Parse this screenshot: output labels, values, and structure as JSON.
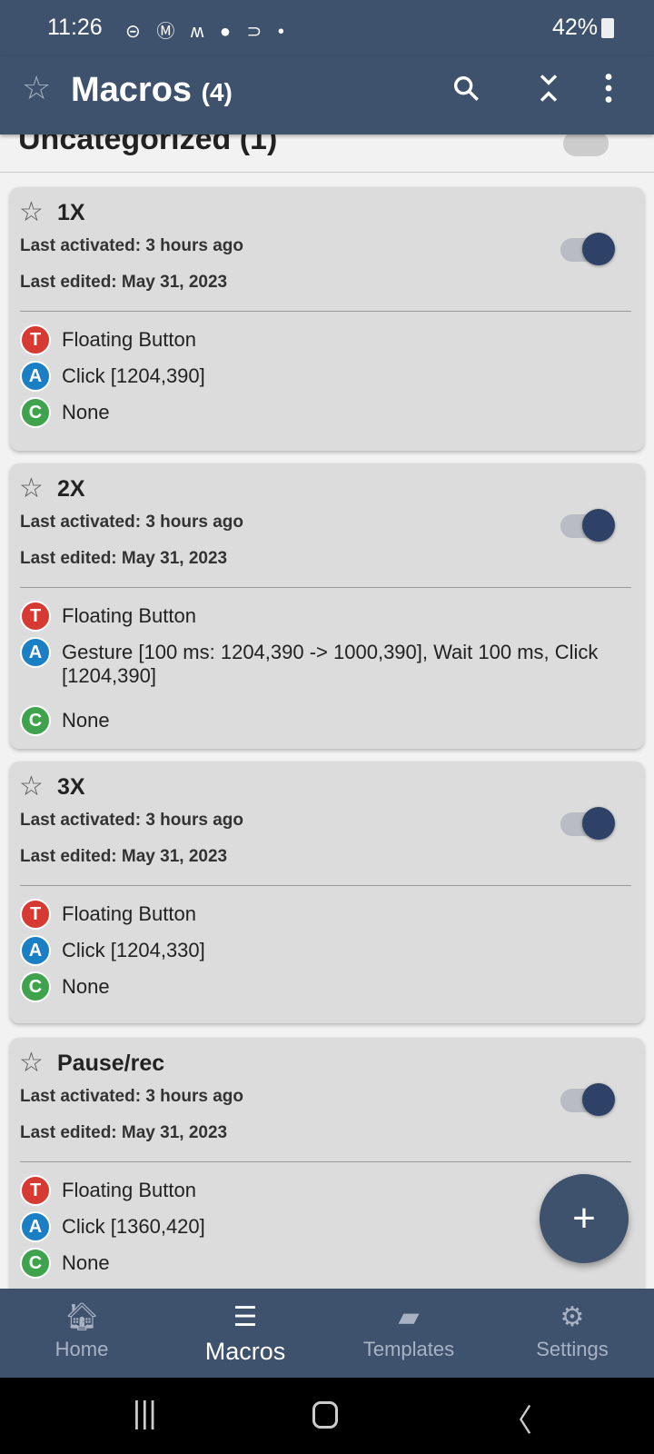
{
  "status_bar": {
    "time": "11:26",
    "notification_icons": "⊝ Ⓜ ʍ ● ⊃ •",
    "signal": "42%"
  },
  "app_bar": {
    "title": "Macros",
    "count": "(4)",
    "icons": [
      "star-icon",
      "search-icon",
      "collapse-icon",
      "more-icon"
    ]
  },
  "category": {
    "title": "Uncategorized (1)",
    "enabled": false
  },
  "macros": [
    {
      "name": "1X",
      "last_activated": "Last activated: 3 hours ago",
      "last_edited": "Last edited: May 31, 2023",
      "enabled": true,
      "trigger": "Floating Button",
      "action": "Click [1204,390]",
      "constraint": "None"
    },
    {
      "name": "2X",
      "last_activated": "Last activated: 3 hours ago",
      "last_edited": "Last edited: May 31, 2023",
      "enabled": true,
      "trigger": "Floating Button",
      "action": "Gesture [100 ms: 1204,390 -> 1000,390], Wait 100 ms, Click [1204,390]",
      "constraint": "None"
    },
    {
      "name": "3X",
      "last_activated": "Last activated: 3 hours ago",
      "last_edited": "Last edited: May 31, 2023",
      "enabled": true,
      "trigger": "Floating Button",
      "action": "Click [1204,330]",
      "constraint": "None"
    },
    {
      "name": "Pause/rec",
      "last_activated": "Last activated: 3 hours ago",
      "last_edited": "Last edited: May 31, 2023",
      "enabled": true,
      "trigger": "Floating Button",
      "action": "Click [1360,420]",
      "constraint": "None"
    }
  ],
  "badges": {
    "trigger": "T",
    "action": "A",
    "constraint": "C"
  },
  "colors": {
    "trigger": "#d63a32",
    "action": "#1a7fc4",
    "constraint": "#3fa34d",
    "primary": "#3e526e"
  },
  "fab": "+",
  "nav": [
    {
      "label": "Home"
    },
    {
      "label": "Macros",
      "active": true
    },
    {
      "label": "Templates"
    },
    {
      "label": "Settings"
    }
  ]
}
